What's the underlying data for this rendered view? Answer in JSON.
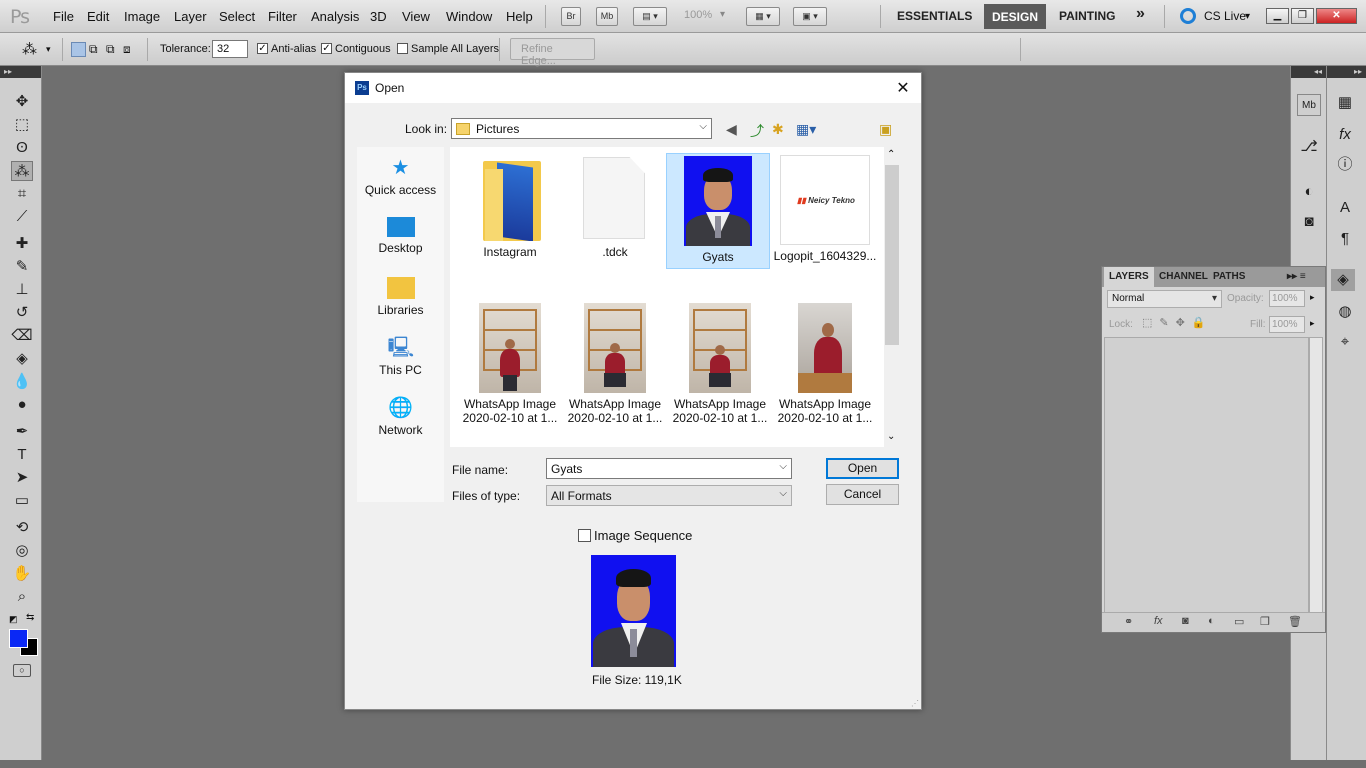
{
  "menubar": {
    "logo": "Ps",
    "items": [
      "File",
      "Edit",
      "Image",
      "Layer",
      "Select",
      "Filter",
      "Analysis",
      "3D",
      "View",
      "Window",
      "Help"
    ],
    "bridge": "Br",
    "minibridge": "Mb",
    "zoom": "100%",
    "workspaces": [
      "ESSENTIALS",
      "DESIGN",
      "PAINTING"
    ],
    "more": "»",
    "cslive": "CS Live"
  },
  "options": {
    "tolerance_label": "Tolerance:",
    "tolerance_value": "32",
    "antialias_label": "Anti-alias",
    "contiguous_label": "Contiguous",
    "sample_all_label": "Sample All Layers",
    "refine_edge": "Refine Edge..."
  },
  "layers_panel": {
    "tabs": [
      "LAYERS",
      "CHANNEL",
      "PATHS"
    ],
    "blend_mode": "Normal",
    "opacity_label": "Opacity:",
    "opacity_value": "100%",
    "lock_label": "Lock:",
    "fill_label": "Fill:",
    "fill_value": "100%"
  },
  "dialog": {
    "title": "Open",
    "look_in_label": "Look in:",
    "look_in_value": "Pictures",
    "places": [
      "Quick access",
      "Desktop",
      "Libraries",
      "This PC",
      "Network"
    ],
    "files": [
      {
        "name": "Instagram",
        "name2": ""
      },
      {
        "name": ".tdck",
        "name2": ""
      },
      {
        "name": "Gyats",
        "name2": ""
      },
      {
        "name": "Logopit_1604329...",
        "name2": ""
      },
      {
        "name": "WhatsApp Image",
        "name2": "2020-02-10 at 1..."
      },
      {
        "name": "WhatsApp Image",
        "name2": "2020-02-10 at 1..."
      },
      {
        "name": "WhatsApp Image",
        "name2": "2020-02-10 at 1..."
      },
      {
        "name": "WhatsApp Image",
        "name2": "2020-02-10 at 1..."
      }
    ],
    "logo_text": "Neicy Tekno",
    "file_name_label": "File name:",
    "file_name_value": "Gyats",
    "files_of_type_label": "Files of type:",
    "files_of_type_value": "All Formats",
    "open_button": "Open",
    "cancel_button": "Cancel",
    "image_sequence_label": "Image Sequence",
    "file_size": "File Size: 119,1K"
  },
  "colors": {
    "foreground": "#0a28f5",
    "background": "#000000",
    "accent": "#0078d7"
  }
}
